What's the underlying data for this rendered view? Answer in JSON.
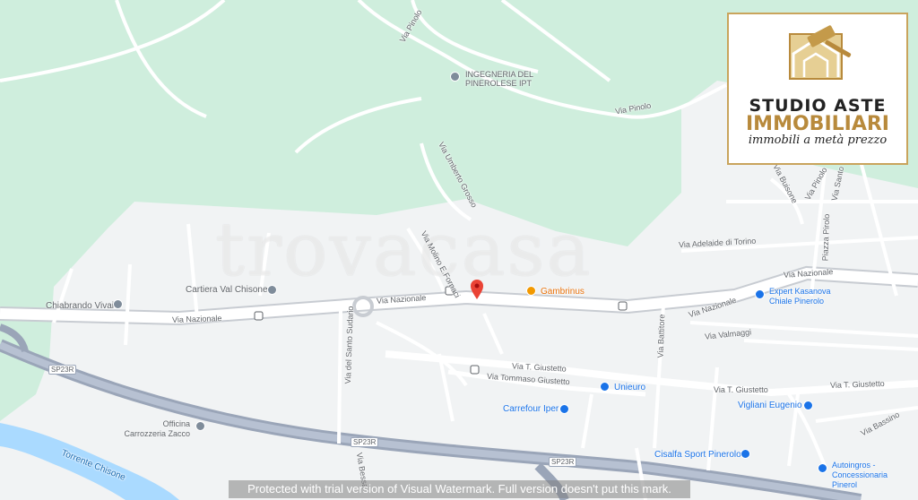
{
  "watermark": "trovacasa",
  "trial_notice": "Protected with trial version of Visual Watermark. Full version doesn't put this mark.",
  "logo": {
    "line1": "STUDIO ASTE",
    "line2": "IMMOBILIARI",
    "tagline": "immobili a metà prezzo"
  },
  "streets": {
    "via_pinolo_top": "Via Pinolo",
    "via_pinolo_mid": "Via Pinolo",
    "via_pinolo_right": "Via Pinolo",
    "via_buisone": "Via Buisone",
    "via_umberto_grosso": "Via Umberto Grosso",
    "via_molino": "Via Molino E.Fornaci",
    "via_adelaide": "Via Adelaide di Torino",
    "piazza_pirolo": "Piazza Pirolo",
    "via_nazionale_1": "Via Nazionale",
    "via_nazionale_2": "Via Nazionale",
    "via_nazionale_3": "Via Nazionale",
    "via_nazionale_4": "Via Nazionale",
    "via_valmaggi": "Via Valmaggi",
    "via_sant_sudario": "Via del Santo Sudario",
    "via_battitore": "Via Battitore",
    "via_giustetto_1": "Via T. Giustetto",
    "via_tommaso": "Via Tommaso Giustetto",
    "via_giustetto_2": "Via T. Giustetto",
    "via_giustetto_3": "Via T. Giustetto",
    "via_bassino": "Via Bassino",
    "via_bessa": "Via Bessa",
    "via_santo_right": "Via Santo",
    "sp23r_1": "SP23R",
    "sp23r_2": "SP23R",
    "sp23r_3": "SP23R",
    "river": "Torrente Chisone"
  },
  "pois": {
    "ingegneria": "INGEGNERIA DEL PINEROLESE IPT",
    "cartiera": "Cartiera Val Chisone",
    "chiabrando": "Chiabrando Vivai",
    "gambrinus": "Gambrinus",
    "expert": "Expert Kasanova Chiale Pinerolo",
    "unieuro": "Unieuro",
    "carrefour": "Carrefour Iper",
    "vigliani": "Vigliani Eugenio",
    "officina": "Officina Carrozzeria Zacco",
    "cisalfa": "Cisalfa Sport Pinerolo",
    "autoingros": "Autoingros - Concessionaria Pinerol"
  },
  "colors": {
    "park": "#cfeedd",
    "urban": "#f1f3f4",
    "road": "#ffffff",
    "highway": "#9aa5b8",
    "water": "#aadaff",
    "pin": "#ea4335",
    "logo_gold": "#c9a45c"
  }
}
